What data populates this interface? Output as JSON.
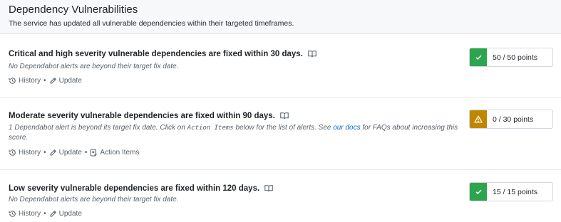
{
  "section": {
    "title": "Dependency Vulnerabilities",
    "subtitle": "The service has updated all vulnerable dependencies within their targeted timeframes."
  },
  "rules": [
    {
      "title": "Critical and high severity vulnerable dependencies are fixed within 30 days.",
      "description": "No Dependabot alerts are beyond their target fix date.",
      "history_label": "History",
      "update_label": "Update",
      "score": "50 / 50 points",
      "status": "pass"
    },
    {
      "title": "Moderate severity vulnerable dependencies are fixed within 90 days.",
      "description_pre": "1 Dependabot alert is beyond its target fix date. Click on ",
      "description_code": "Action Items",
      "description_mid": " below for the list of alerts. See ",
      "description_link": "our docs",
      "description_post": " for FAQs about increasing this score.",
      "history_label": "History",
      "update_label": "Update",
      "action_items_label": "Action Items",
      "score": "0 / 30 points",
      "status": "warning"
    },
    {
      "title": "Low severity vulnerable dependencies are fixed within 120 days.",
      "description": "No Dependabot alerts are beyond their target fix date.",
      "history_label": "History",
      "update_label": "Update",
      "score": "15 / 15 points",
      "status": "pass"
    }
  ],
  "colors": {
    "pass": "#2da44e",
    "warning": "#bf8700",
    "link": "#0969da"
  },
  "icons": {
    "docs": "book-icon",
    "history": "history-icon",
    "update": "pencil-icon",
    "action_items": "checklist-icon",
    "pass": "check-icon",
    "warning": "alert-icon"
  }
}
